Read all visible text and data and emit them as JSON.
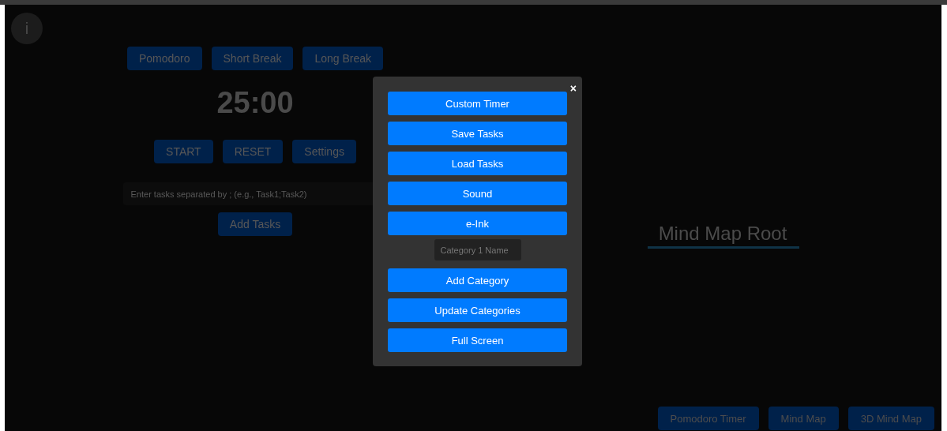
{
  "info_button": {
    "label": "i"
  },
  "timer_modes": [
    "Pomodoro",
    "Short Break",
    "Long Break"
  ],
  "timer": {
    "display": "25:00"
  },
  "timer_controls": [
    "START",
    "RESET",
    "Settings"
  ],
  "task_input": {
    "placeholder": "Enter tasks separated by ; (e.g., Task1;Task2)"
  },
  "add_tasks_button": "Add Tasks",
  "mind_map": {
    "root": "Mind Map Root"
  },
  "view_nav": [
    "Pomodoro Timer",
    "Mind Map",
    "3D Mind Map"
  ],
  "modal": {
    "close": "×",
    "items": [
      {
        "kind": "button",
        "label": "Custom Timer"
      },
      {
        "kind": "button",
        "label": "Save Tasks"
      },
      {
        "kind": "button",
        "label": "Load Tasks"
      },
      {
        "kind": "button",
        "label": "Sound"
      },
      {
        "kind": "button",
        "label": "e-Ink"
      },
      {
        "kind": "input",
        "placeholder": "Category 1 Name"
      },
      {
        "kind": "button",
        "label": "Add Category"
      },
      {
        "kind": "button",
        "label": "Update Categories"
      },
      {
        "kind": "button",
        "label": "Full Screen"
      }
    ]
  }
}
